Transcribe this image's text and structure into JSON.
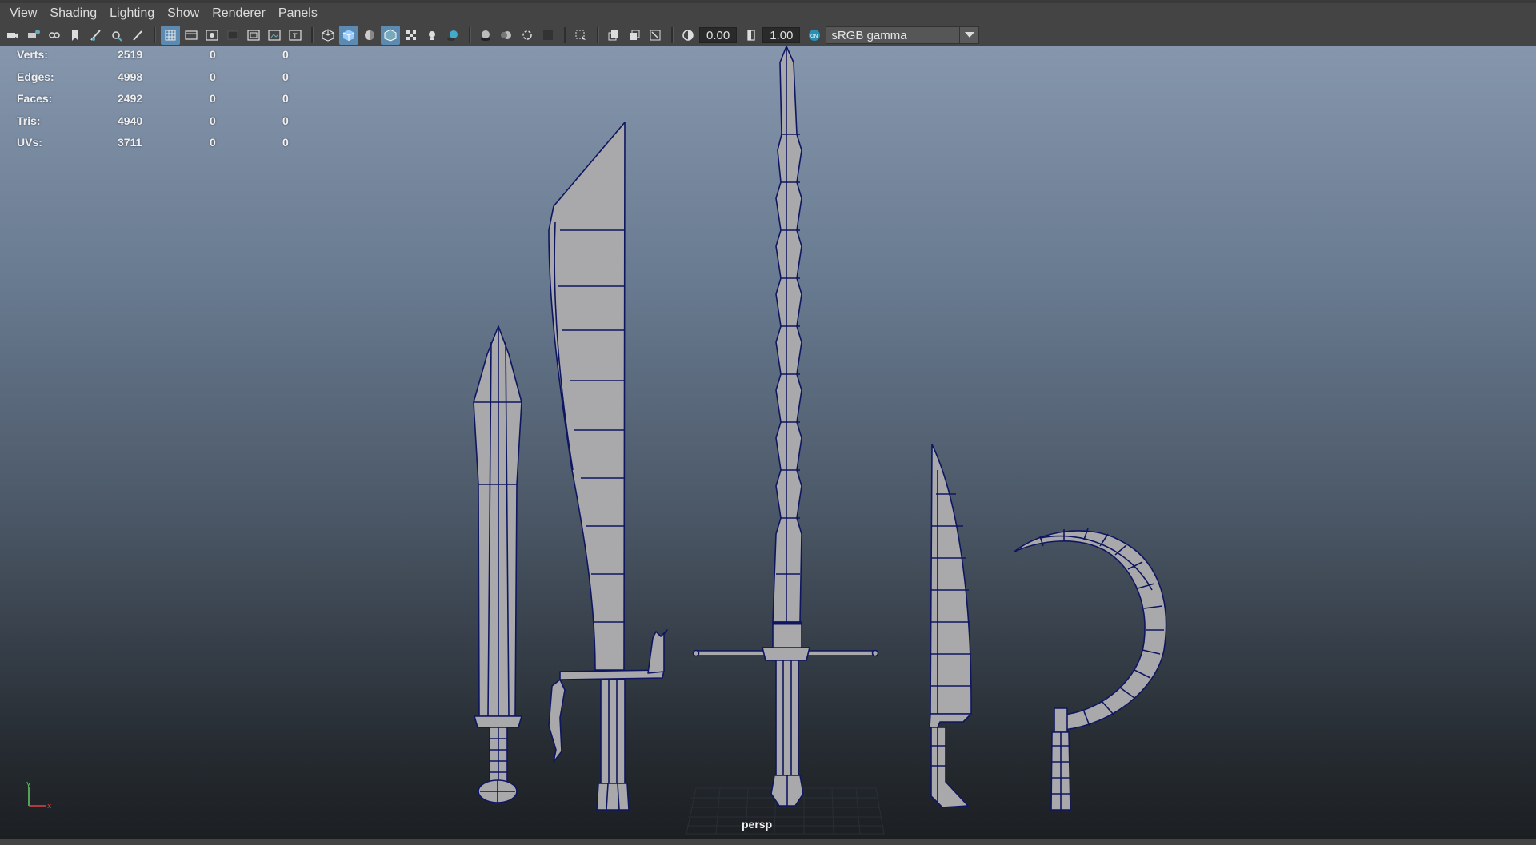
{
  "menubar": {
    "items": [
      "View",
      "Shading",
      "Lighting",
      "Show",
      "Renderer",
      "Panels"
    ]
  },
  "toolbar": {
    "exposure_value": "0.00",
    "gamma_value": "1.00",
    "color_space": "sRGB gamma",
    "icons": [
      "select-camera-icon",
      "camera-attributes-icon",
      "bookmark-icon",
      "image-plane-icon",
      "grease-pencil-icon",
      "grid-icon",
      "film-gate-icon",
      "resolution-gate-icon",
      "gate-mask-icon",
      "field-chart-icon",
      "safe-action-icon",
      "safe-title-icon",
      "wireframe-icon",
      "smooth-shade-icon",
      "default-material-icon",
      "wireframe-on-shaded-icon",
      "textured-icon",
      "lights-icon",
      "shadows-icon",
      "screen-space-ao-icon",
      "motion-blur-icon",
      "anti-aliasing-icon",
      "depth-of-field-icon",
      "isolate-select-icon",
      "xray-icon",
      "xray-joints-icon",
      "xray-components-icon",
      "exposure-icon",
      "gamma-icon",
      "color-management-icon"
    ]
  },
  "hud": {
    "rows": [
      {
        "label": "Verts:",
        "v1": "2519",
        "v2": "0",
        "v3": "0"
      },
      {
        "label": "Edges:",
        "v1": "4998",
        "v2": "0",
        "v3": "0"
      },
      {
        "label": "Faces:",
        "v1": "2492",
        "v2": "0",
        "v3": "0"
      },
      {
        "label": "Tris:",
        "v1": "4940",
        "v2": "0",
        "v3": "0"
      },
      {
        "label": "UVs:",
        "v1": "3711",
        "v2": "0",
        "v3": "0"
      }
    ]
  },
  "viewport": {
    "camera": "persp",
    "axis_y": "y",
    "axis_x": "x",
    "colors": {
      "wire": "#0f1660",
      "mesh_fill": "#a9a9ab",
      "accent": "#5c8ab0"
    }
  }
}
